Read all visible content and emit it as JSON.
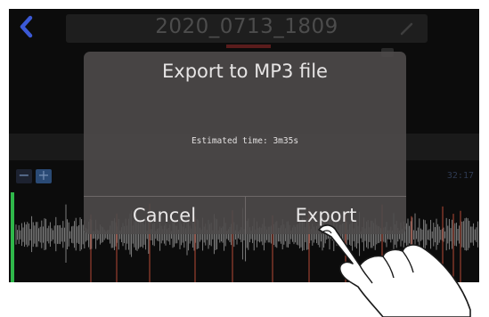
{
  "header": {
    "title": "2020_0713_1809",
    "back_icon": "chevron-left-icon",
    "edit_icon": "pencil-icon"
  },
  "timeline": {
    "zoom_out_label": "−",
    "zoom_in_label": "+",
    "time": "32:17"
  },
  "dialog": {
    "title": "Export to MP3 file",
    "estimated_time": "Estimated time: 3m35s",
    "cancel_label": "Cancel",
    "export_label": "Export"
  },
  "colors": {
    "accent": "#3b59d6",
    "waveform": "#8a8a8a",
    "marker_red": "#9a4030",
    "playhead_green": "#2fb84a"
  }
}
